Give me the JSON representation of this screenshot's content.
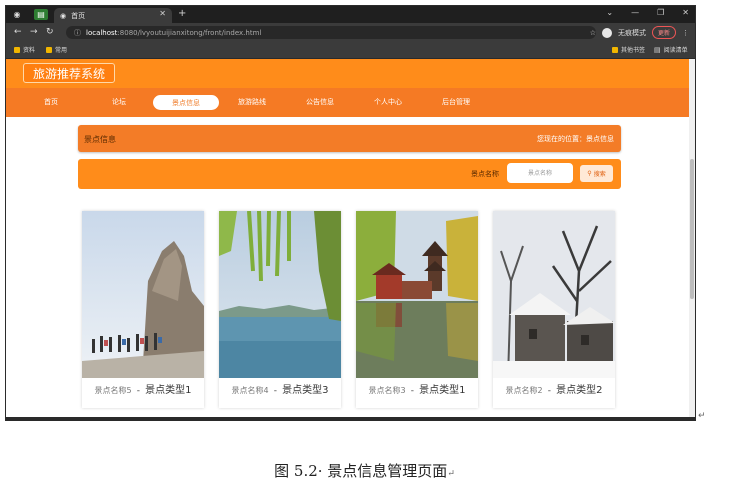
{
  "browser": {
    "tab": {
      "title": "首页"
    },
    "url": {
      "host": "localhost",
      "path": ":8080/lvyoutuijianxitong/front/index.html"
    },
    "incognito_label": "无痕模式",
    "update_label": "更新",
    "bookmarks": [
      {
        "label": "资料"
      },
      {
        "label": "常用"
      }
    ],
    "bookmarks_right": [
      {
        "label": "其他书签"
      },
      {
        "label": "阅读清单"
      }
    ]
  },
  "site": {
    "logo": "旅游推荐系统",
    "nav": [
      {
        "label": "首页",
        "active": false
      },
      {
        "label": "论坛",
        "active": false
      },
      {
        "label": "景点信息",
        "active": true
      },
      {
        "label": "旅游路线",
        "active": false
      },
      {
        "label": "公告信息",
        "active": false
      },
      {
        "label": "个人中心",
        "active": false
      },
      {
        "label": "后台管理",
        "active": false
      }
    ],
    "section_title": "景点信息",
    "position_text": "您现在的位置：景点信息",
    "search": {
      "label": "景点名称",
      "placeholder": "景点名称",
      "button_label": "搜索"
    },
    "cards": [
      {
        "name": "景点名称5",
        "separator": "-",
        "type": "景点类型1",
        "image": "rock-cliff-tourists-icon"
      },
      {
        "name": "景点名称4",
        "separator": "-",
        "type": "景点类型3",
        "image": "lake-willow-icon"
      },
      {
        "name": "景点名称3",
        "separator": "-",
        "type": "景点类型1",
        "image": "pagoda-reflection-icon"
      },
      {
        "name": "景点名称2",
        "separator": "-",
        "type": "景点类型2",
        "image": "snow-village-icon"
      }
    ]
  },
  "caption": "图 5.2· 景点信息管理页面",
  "colors": {
    "header": "#ff8c1a",
    "nav": "#f57a24",
    "accent": "#f08030"
  }
}
